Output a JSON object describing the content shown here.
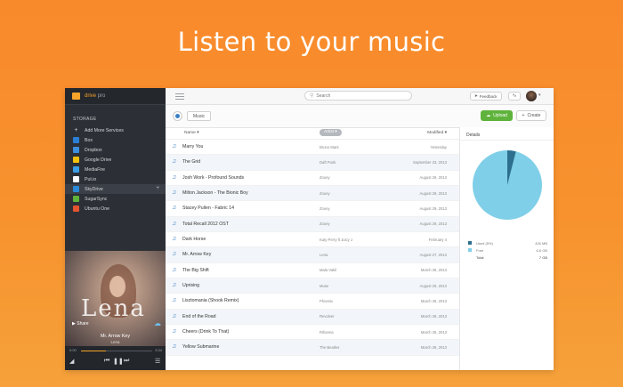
{
  "headline": "Listen to your music",
  "sidebar": {
    "app_name": "drive",
    "app_suffix": "pro",
    "storage_label": "STORAGE",
    "services": [
      {
        "label": "Add More Services",
        "icon": "plus-icon",
        "color": "#cfd2d6"
      },
      {
        "label": "Box",
        "icon": "box-icon",
        "color": "#2a7fd4"
      },
      {
        "label": "Dropbox",
        "icon": "dropbox-icon",
        "color": "#3d8fe0"
      },
      {
        "label": "Google Drive",
        "icon": "google-drive-icon",
        "color": "#f4c20d"
      },
      {
        "label": "MediaFire",
        "icon": "mediafire-icon",
        "color": "#3b9ee6"
      },
      {
        "label": "Put.io",
        "icon": "putio-icon",
        "color": "#ffffff"
      },
      {
        "label": "SkyDrive",
        "icon": "skydrive-icon",
        "color": "#2b8ad8"
      },
      {
        "label": "SugarSync",
        "icon": "sugarsync-icon",
        "color": "#5fb33c"
      },
      {
        "label": "Ubuntu One",
        "icon": "ubuntu-one-icon",
        "color": "#e5532f"
      }
    ],
    "active_index": 6
  },
  "now_playing": {
    "album_text": "Lena",
    "share_label": "Share",
    "track": "Mr. Arrow Key",
    "artist": "Lena",
    "elapsed": "0:00",
    "duration": "3:34",
    "progress_fraction": 0.35
  },
  "toolbar": {
    "search_placeholder": "Search",
    "feedback_label": "Feedback"
  },
  "breadcrumb": {
    "current": "Music"
  },
  "actions": {
    "upload_label": "Upload",
    "create_label": "Create"
  },
  "columns": {
    "name": "Name",
    "artist": "Artist",
    "modified": "Modified"
  },
  "files": [
    {
      "name": "Marry You",
      "artist": "Bruno Mars",
      "modified": "Yesterday"
    },
    {
      "name": "The Grid",
      "artist": "Daft Punk",
      "modified": "September 23, 2013"
    },
    {
      "name": "Josh Work - Profound Sounds",
      "artist": "Zooey",
      "modified": "August 29, 2013"
    },
    {
      "name": "Milton Jackson - The Bionic Boy",
      "artist": "Zooey",
      "modified": "August 29, 2013"
    },
    {
      "name": "Stacey Pullen - Fabric 14",
      "artist": "Zooey",
      "modified": "August 29, 2013"
    },
    {
      "name": "Total Recall 2012 OST",
      "artist": "Zooey",
      "modified": "August 29, 2013"
    },
    {
      "name": "Dark Horse",
      "artist": "Katy Perry ft Juicy J",
      "modified": "February 4"
    },
    {
      "name": "Mr. Arrow Key",
      "artist": "Lena",
      "modified": "August 27, 2013"
    },
    {
      "name": "The Big Shift",
      "artist": "Mala Vakil",
      "modified": "March 26, 2013"
    },
    {
      "name": "Uprising",
      "artist": "Muse",
      "modified": "August 29, 2013"
    },
    {
      "name": "Lisztomania (Shook Remix)",
      "artist": "Phoenix",
      "modified": "March 26, 2013"
    },
    {
      "name": "End of the Road",
      "artist": "Revolver",
      "modified": "March 26, 2013"
    },
    {
      "name": "Cheers (Drink To That)",
      "artist": "Rihanna",
      "modified": "March 26, 2013"
    },
    {
      "name": "Yellow Submarine",
      "artist": "The Beatles",
      "modified": "March 26, 2013"
    }
  ],
  "details": {
    "title": "Details",
    "used_fraction": 0.04,
    "used_color": "#2d6f8e",
    "free_color": "#80cfe8",
    "legend": [
      {
        "label": "Used (5%)",
        "value": "426 MB",
        "color": "#2d6f8e"
      },
      {
        "label": "Free",
        "value": "6.6 GB",
        "color": "#80cfe8"
      },
      {
        "label": "Total",
        "value": "7 GB",
        "color": ""
      }
    ]
  }
}
